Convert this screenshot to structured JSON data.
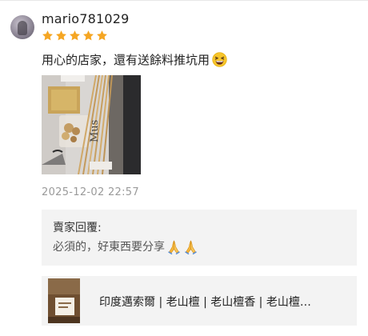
{
  "review": {
    "username": "mario781029",
    "rating": 5,
    "rating_max": 5,
    "text": "用心的店家，還有送餘料推坑用",
    "text_emoji": "grinning-squinting-face-emoji",
    "timestamp": "2025-12-02 22:57",
    "photo_caption_fragment": "Mus"
  },
  "seller_reply": {
    "heading": "賣家回覆:",
    "text": "必須的，好東西要分享",
    "text_emojis": [
      "folded-hands-emoji",
      "folded-hands-emoji"
    ]
  },
  "product": {
    "name": "印度邁索爾 | 老山檀 | 老山檀香 | 老山檀…"
  },
  "colors": {
    "star": "#f5a623",
    "timestamp": "#9a9a9a",
    "panel_bg": "#f3f3f3"
  }
}
